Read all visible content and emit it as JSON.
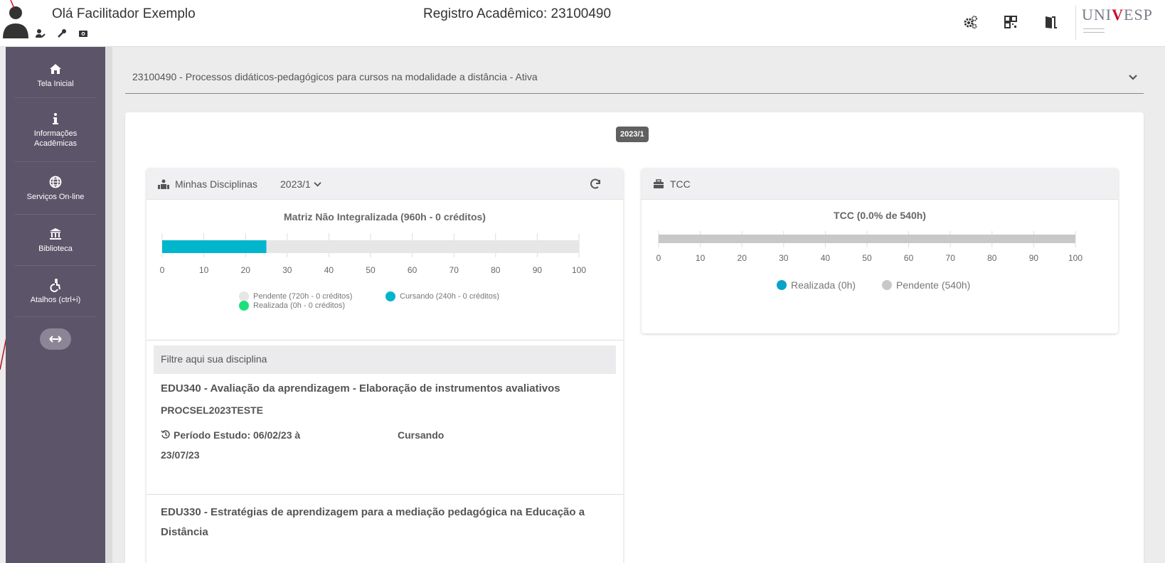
{
  "header": {
    "greeting": "Olá Facilitador Exemplo",
    "registro": "Registro Acadêmico: 23100490",
    "logo_text_a": "UNI",
    "logo_text_v": "V",
    "logo_text_b": "ESP"
  },
  "sidebar": {
    "items": [
      {
        "label": "Tela Inicial",
        "icon": "home-icon"
      },
      {
        "label": "Informações Acadêmicas",
        "icon": "info-icon"
      },
      {
        "label": "Serviços On-line",
        "icon": "globe-icon"
      },
      {
        "label": "Biblioteca",
        "icon": "library-icon"
      },
      {
        "label": "Atalhos (ctrl+i)",
        "icon": "accessibility-icon"
      }
    ]
  },
  "course_select": {
    "value": "23100490 - Processos didáticos-pedagógicos para cursos na modalidade a distância - Ativa"
  },
  "period_badge": "2023/1",
  "disciplinas": {
    "title": "Minhas Disciplinas",
    "period": "2023/1",
    "chart_title": "Matriz Não Integralizada (960h - 0 créditos)",
    "legend": {
      "pendente": "Pendente (720h - 0 créditos)",
      "cursando": "Cursando (240h - 0 créditos)",
      "realizada": "Realizada (0h - 0 créditos)"
    },
    "filter_placeholder": "Filtre aqui sua disciplina",
    "list": [
      {
        "title": "EDU340 - Avaliação da aprendizagem - Elaboração de instrumentos avaliativos",
        "code": "PROCSEL2023TESTE",
        "period_line1": "Período Estudo: 06/02/23 à",
        "period_line2": "23/07/23",
        "status": "Cursando"
      },
      {
        "title_line1": "EDU330 - Estratégias de aprendizagem para a mediação pedagógica na Educação a",
        "title_line2": "Distância"
      }
    ]
  },
  "tcc": {
    "title": "TCC",
    "chart_title": "TCC (0.0% de 540h)",
    "legend": {
      "realizada": "Realizada (0h)",
      "pendente": "Pendente (540h)"
    }
  },
  "colors": {
    "sidebar": "#5c5569",
    "cursando": "#00b5cc",
    "realizada": "#1ee07a",
    "pendente": "#e6e6e6",
    "tcc_realizada": "#0aa3c8",
    "tcc_pendente": "#c8c8c8"
  },
  "chart_data": [
    {
      "type": "bar",
      "orientation": "horizontal-stacked",
      "title": "Matriz Não Integralizada (960h - 0 créditos)",
      "xlim": [
        0,
        100
      ],
      "xticks": [
        0,
        10,
        20,
        30,
        40,
        50,
        60,
        70,
        80,
        90,
        100
      ],
      "series": [
        {
          "name": "Realizada (0h - 0 créditos)",
          "values": [
            0
          ]
        },
        {
          "name": "Cursando (240h - 0 créditos)",
          "values": [
            25
          ]
        },
        {
          "name": "Pendente (720h - 0 créditos)",
          "values": [
            75
          ]
        }
      ]
    },
    {
      "type": "bar",
      "orientation": "horizontal-stacked",
      "title": "TCC (0.0% de 540h)",
      "xlim": [
        0,
        100
      ],
      "xticks": [
        0,
        10,
        20,
        30,
        40,
        50,
        60,
        70,
        80,
        90,
        100
      ],
      "series": [
        {
          "name": "Realizada (0h)",
          "values": [
            0
          ]
        },
        {
          "name": "Pendente (540h)",
          "values": [
            100
          ]
        }
      ]
    }
  ]
}
